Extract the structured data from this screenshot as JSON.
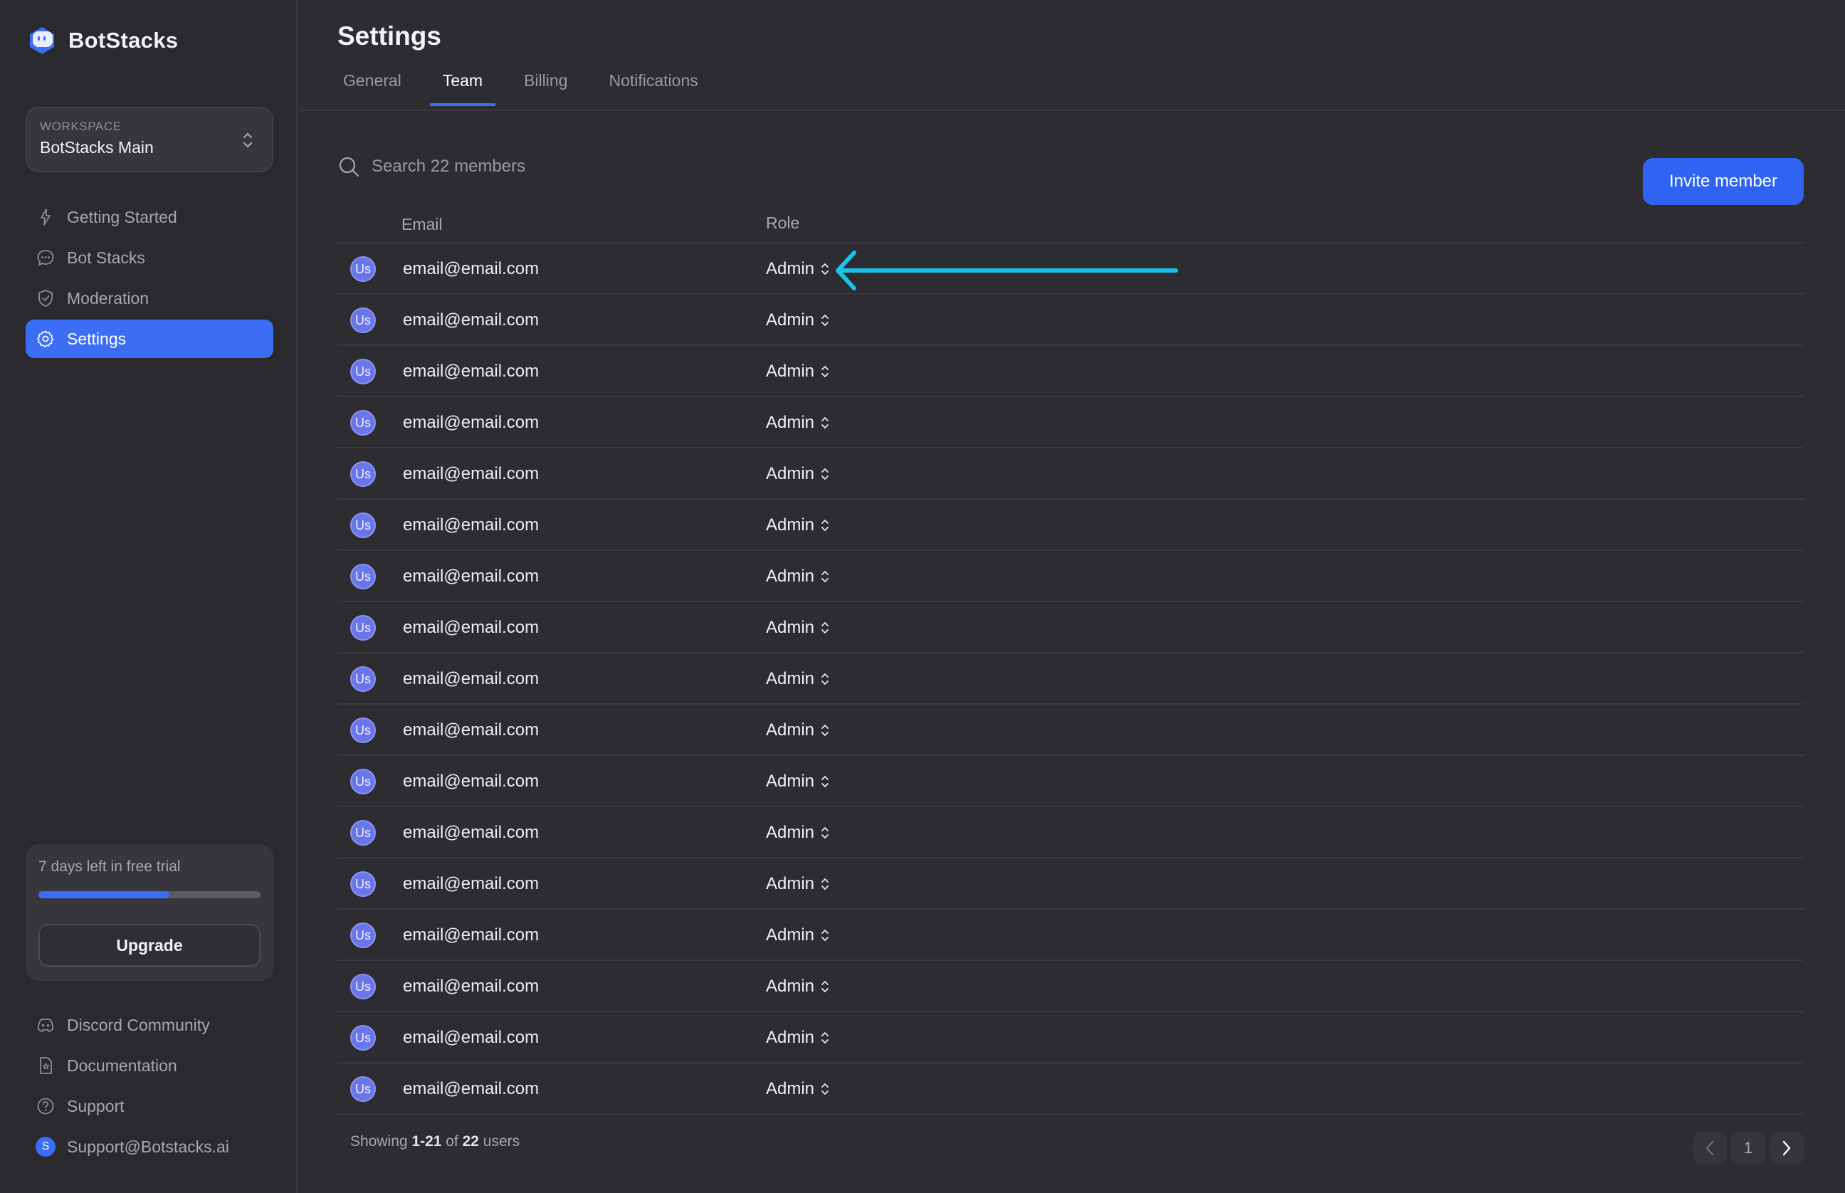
{
  "app": {
    "name": "BotStacks"
  },
  "workspace": {
    "label": "WORKSPACE",
    "name": "BotStacks Main"
  },
  "nav": [
    {
      "label": "Getting Started",
      "icon": "bolt-icon"
    },
    {
      "label": "Bot Stacks",
      "icon": "chat-icon"
    },
    {
      "label": "Moderation",
      "icon": "shield-icon"
    },
    {
      "label": "Settings",
      "icon": "gear-icon",
      "active": true
    }
  ],
  "trial": {
    "text": "7 days left in free trial",
    "progress_percent": 59,
    "upgrade_label": "Upgrade"
  },
  "bottom_nav": [
    {
      "label": "Discord Community",
      "icon": "discord-icon"
    },
    {
      "label": "Documentation",
      "icon": "document-icon"
    },
    {
      "label": "Support",
      "icon": "help-icon"
    },
    {
      "label": "Support@Botstacks.ai",
      "avatar_initial": "S"
    }
  ],
  "page": {
    "title": "Settings"
  },
  "tabs": [
    {
      "label": "General"
    },
    {
      "label": "Team",
      "active": true
    },
    {
      "label": "Billing"
    },
    {
      "label": "Notifications"
    }
  ],
  "search": {
    "placeholder": "Search 22 members"
  },
  "invite_label": "Invite member",
  "table": {
    "columns": [
      "Email",
      "Role"
    ],
    "rows": [
      {
        "initials": "Us",
        "email": "email@email.com",
        "role": "Admin"
      },
      {
        "initials": "Us",
        "email": "email@email.com",
        "role": "Admin"
      },
      {
        "initials": "Us",
        "email": "email@email.com",
        "role": "Admin"
      },
      {
        "initials": "Us",
        "email": "email@email.com",
        "role": "Admin"
      },
      {
        "initials": "Us",
        "email": "email@email.com",
        "role": "Admin"
      },
      {
        "initials": "Us",
        "email": "email@email.com",
        "role": "Admin"
      },
      {
        "initials": "Us",
        "email": "email@email.com",
        "role": "Admin"
      },
      {
        "initials": "Us",
        "email": "email@email.com",
        "role": "Admin"
      },
      {
        "initials": "Us",
        "email": "email@email.com",
        "role": "Admin"
      },
      {
        "initials": "Us",
        "email": "email@email.com",
        "role": "Admin"
      },
      {
        "initials": "Us",
        "email": "email@email.com",
        "role": "Admin"
      },
      {
        "initials": "Us",
        "email": "email@email.com",
        "role": "Admin"
      },
      {
        "initials": "Us",
        "email": "email@email.com",
        "role": "Admin"
      },
      {
        "initials": "Us",
        "email": "email@email.com",
        "role": "Admin"
      },
      {
        "initials": "Us",
        "email": "email@email.com",
        "role": "Admin"
      },
      {
        "initials": "Us",
        "email": "email@email.com",
        "role": "Admin"
      },
      {
        "initials": "Us",
        "email": "email@email.com",
        "role": "Admin"
      }
    ]
  },
  "footer": {
    "prefix": "Showing ",
    "range": "1-21",
    "middle": " of ",
    "total": "22",
    "suffix": " users"
  },
  "pagination": {
    "current": "1"
  },
  "colors": {
    "accent": "#3c6ef5",
    "annotation_arrow": "#19c3ea",
    "avatar": "#6976ea"
  }
}
